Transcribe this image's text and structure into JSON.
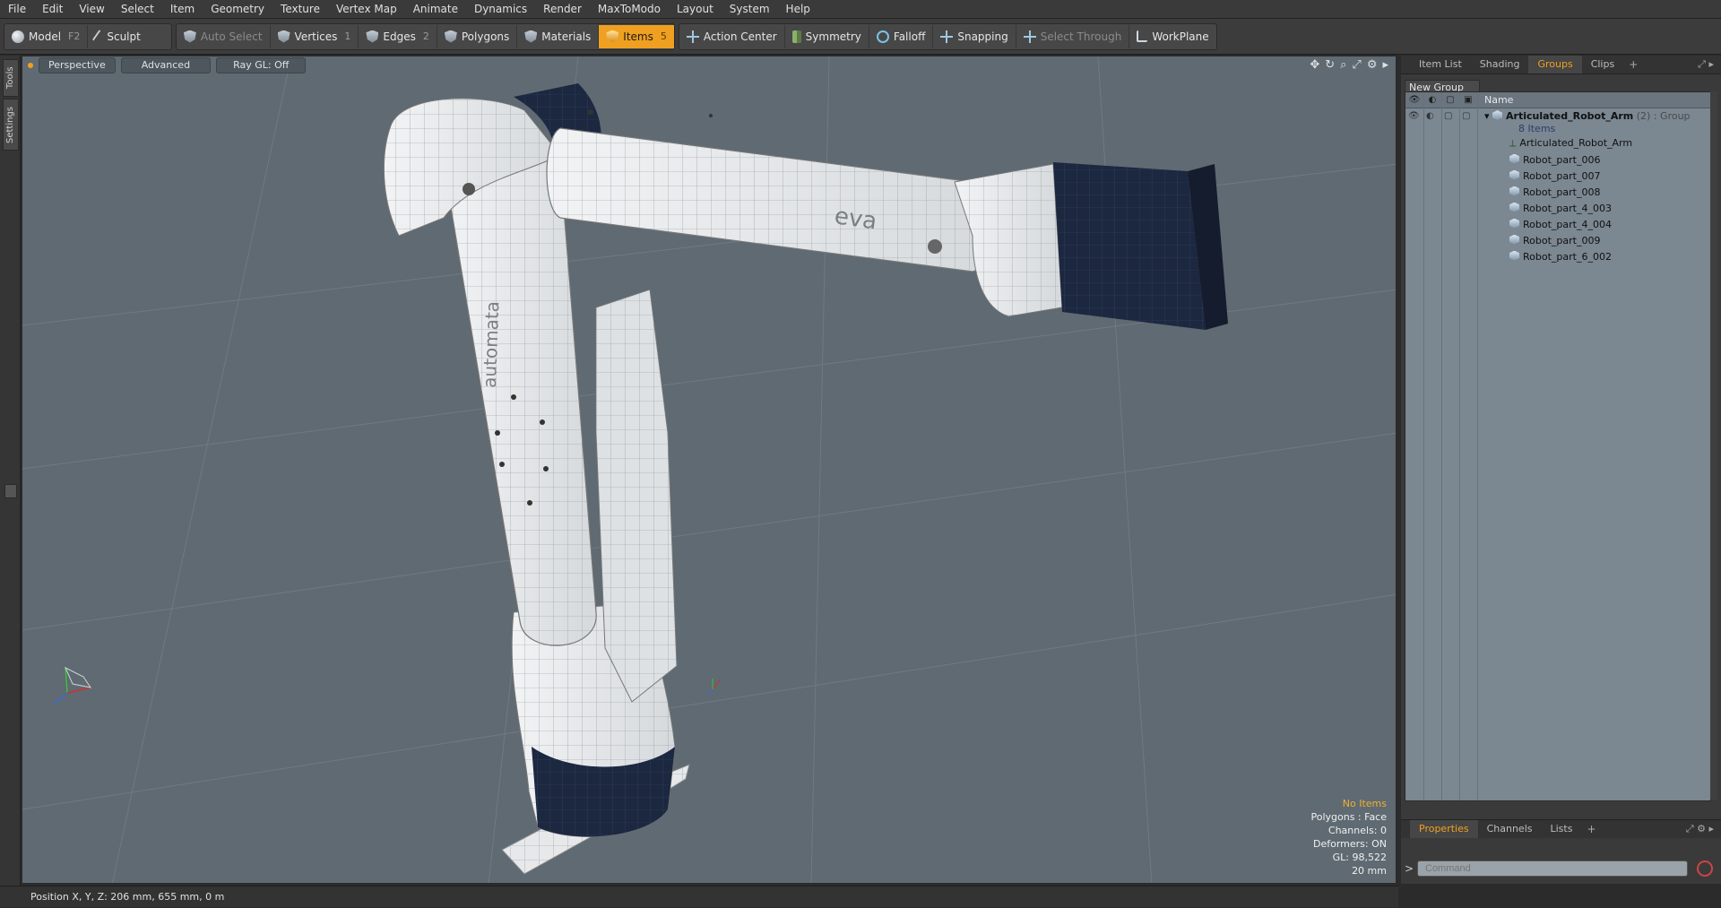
{
  "menu": [
    "File",
    "Edit",
    "View",
    "Select",
    "Item",
    "Geometry",
    "Texture",
    "Vertex Map",
    "Animate",
    "Dynamics",
    "Render",
    "MaxToModo",
    "Layout",
    "System",
    "Help"
  ],
  "toolbar": {
    "model": "Model",
    "model_key": "F2",
    "sculpt": "Sculpt",
    "auto_select": "Auto Select",
    "vertices": "Vertices",
    "vertices_key": "1",
    "edges": "Edges",
    "edges_key": "2",
    "polygons": "Polygons",
    "materials": "Materials",
    "items": "Items",
    "items_key": "5",
    "action_center": "Action Center",
    "symmetry": "Symmetry",
    "falloff": "Falloff",
    "snapping": "Snapping",
    "select_through": "Select Through",
    "workplane": "WorkPlane"
  },
  "left_tabs": [
    "Tools",
    "Settings"
  ],
  "viewport": {
    "view_mode": "Perspective",
    "shading": "Advanced",
    "raygl": "Ray GL: Off",
    "hud": {
      "selection": "No Items",
      "polygons": "Polygons : Face",
      "channels": "Channels: 0",
      "deformers": "Deformers: ON",
      "gl": "GL: 98,522",
      "scale": "20 mm"
    },
    "arm_text_1": "automata",
    "arm_text_2": "eva"
  },
  "status": "Position X, Y, Z:   206 mm, 655 mm, 0 m",
  "right_panel": {
    "tabs": [
      "Item List",
      "Shading",
      "Groups",
      "Clips"
    ],
    "active_tab": "Groups",
    "new_group": "New Group",
    "column_name": "Name",
    "group": {
      "name": "Articulated_Robot_Arm",
      "meta": "(2) : Group",
      "count": "8 Items"
    },
    "items": [
      "Articulated_Robot_Arm",
      "Robot_part_006",
      "Robot_part_007",
      "Robot_part_008",
      "Robot_part_4_003",
      "Robot_part_4_004",
      "Robot_part_009",
      "Robot_part_6_002"
    ],
    "bottom_tabs": [
      "Properties",
      "Channels",
      "Lists"
    ],
    "bottom_active": "Properties",
    "command_placeholder": "Command"
  },
  "colors": {
    "accent": "#f0a020",
    "viewport_bg": "#5f6a72",
    "arm_white": "#e8eaec",
    "arm_navy": "#1c2740"
  }
}
